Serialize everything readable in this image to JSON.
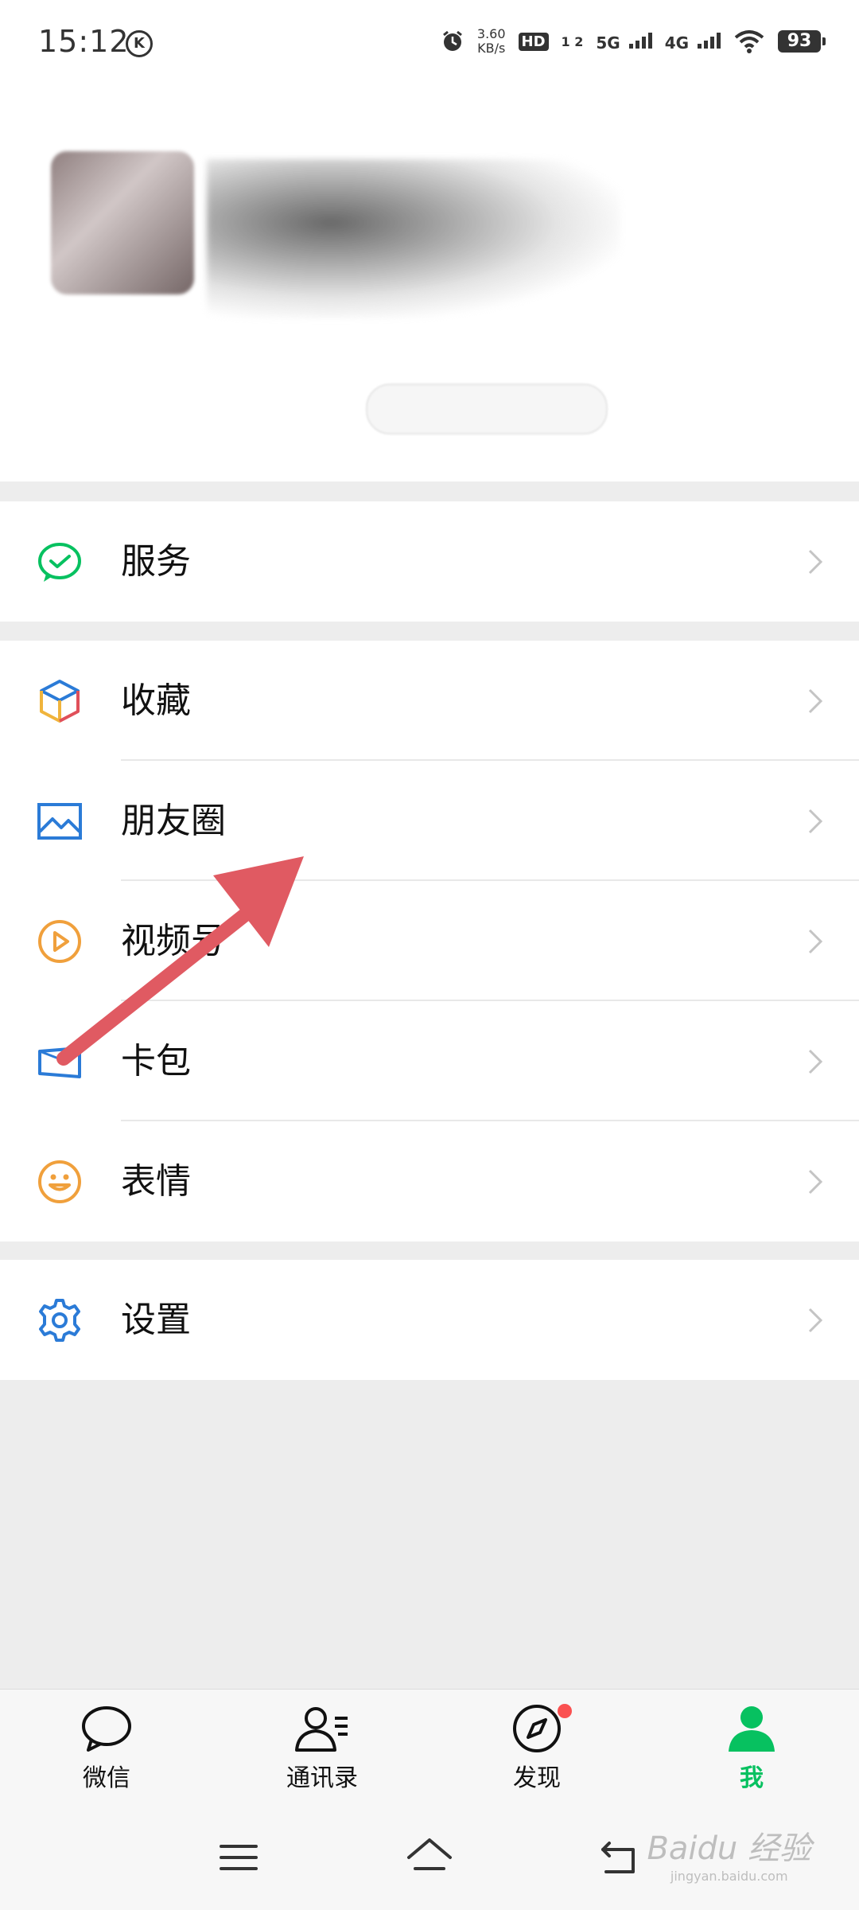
{
  "status_bar": {
    "time": "15:12",
    "k_badge": "K",
    "net_speed": "3.60",
    "net_unit": "KB/s",
    "hd_badge": "HD",
    "sim_label": "1 2",
    "net_5g": "5G",
    "net_4g": "4G",
    "battery": "93"
  },
  "menu": {
    "service": "服务",
    "favorites": "收藏",
    "moments": "朋友圈",
    "channels": "视频号",
    "cards": "卡包",
    "stickers": "表情",
    "settings": "设置"
  },
  "tabs": [
    {
      "label": "微信",
      "icon": "chat-bubble-icon",
      "active": false
    },
    {
      "label": "通讯录",
      "icon": "contacts-icon",
      "active": false
    },
    {
      "label": "发现",
      "icon": "compass-icon",
      "active": false,
      "badge_dot": true
    },
    {
      "label": "我",
      "icon": "person-icon",
      "active": true
    }
  ],
  "watermark": {
    "text": "Baidu 经验",
    "sub": "jingyan.baidu.com"
  },
  "colors": {
    "accent_green": "#07c160",
    "arrow_red": "#e05a62",
    "badge_red": "#fa5151",
    "icon_blue": "#2b7bd7",
    "icon_orange": "#f0a03c"
  }
}
